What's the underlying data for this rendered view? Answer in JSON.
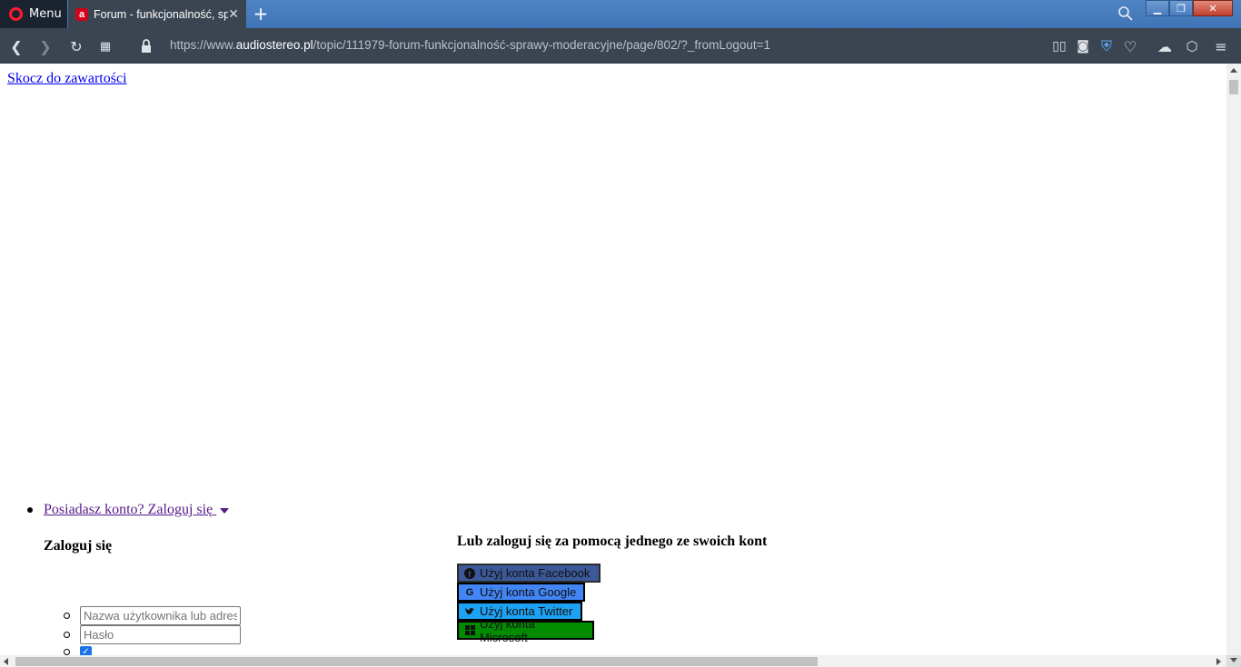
{
  "browser": {
    "menu_label": "Menu",
    "tab_title": "Forum - funkcjonalność, sprawy moderacyjne",
    "tab_favicon_letter": "a",
    "url_prefix": "https://www.",
    "url_domain": "audiostereo.pl",
    "url_path": "/topic/111979-forum-funkcjonalność-sprawy-moderacyjne/page/802/?_fromLogout=1",
    "accent_color": "#ff1b2d"
  },
  "page": {
    "skip_link": "Skocz do zawartości",
    "login_toggle": "Posiadasz konto? Zaloguj się ",
    "login_heading": "Zaloguj się",
    "social_heading": "Lub zaloguj się za pomocą jednego ze swoich kont",
    "username_placeholder": "Nazwa użytkownika lub adres e-mail",
    "password_placeholder": "Hasło",
    "remember_checked": true,
    "social_buttons": [
      {
        "label": "Użyj konta Facebook",
        "icon": "facebook-icon",
        "color": "#3b5998"
      },
      {
        "label": "Użyj konta Google",
        "icon": "google-icon",
        "color": "#4285f4"
      },
      {
        "label": "Użyj konta Twitter",
        "icon": "twitter-icon",
        "color": "#1da1f2"
      },
      {
        "label": "Użyj konta Microsoft",
        "icon": "microsoft-icon",
        "color": "#008b00"
      }
    ]
  }
}
